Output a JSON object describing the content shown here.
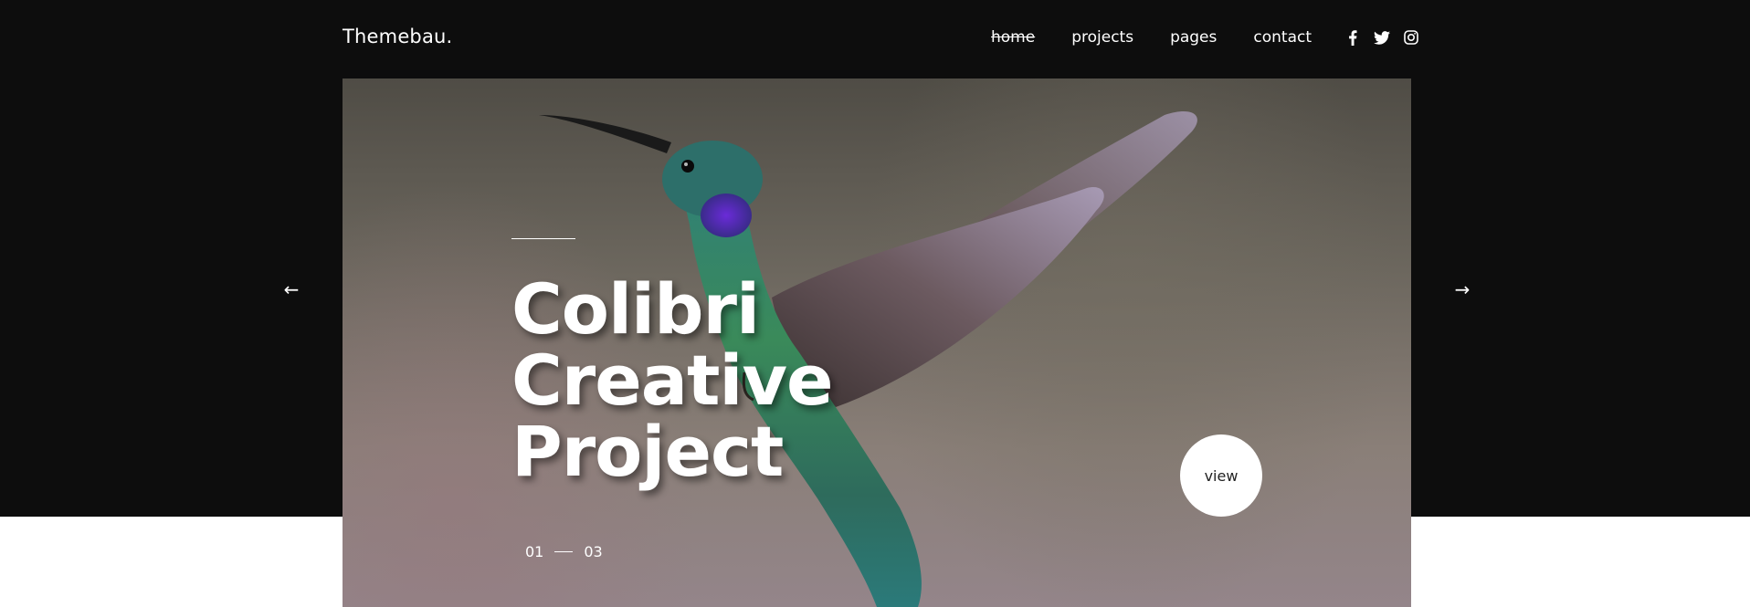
{
  "brand": {
    "logo": "Themebau."
  },
  "nav": {
    "items": [
      {
        "label": "home",
        "active": true
      },
      {
        "label": "projects",
        "active": false
      },
      {
        "label": "pages",
        "active": false
      },
      {
        "label": "contact",
        "active": false
      }
    ]
  },
  "social": {
    "icons": [
      "facebook-icon",
      "twitter-icon",
      "instagram-icon"
    ]
  },
  "hero": {
    "title_line1": "Colibri Creative",
    "title_line2": "Project",
    "view_label": "view",
    "counter_current": "01",
    "counter_total": "03",
    "prev_arrow": "←",
    "next_arrow": "→"
  },
  "colors": {
    "header_bg": "#0d0d0d",
    "page_bg": "#ffffff",
    "text_light": "#ffffff"
  }
}
